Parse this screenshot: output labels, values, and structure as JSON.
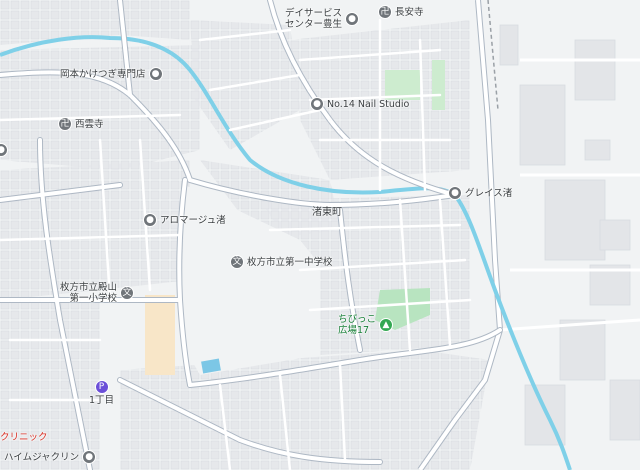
{
  "map": {
    "area_label": "渚東町",
    "pois": [
      {
        "id": "okamoto",
        "label": "岡本かけつぎ専門店",
        "icon": "shop-icon"
      },
      {
        "id": "saiun",
        "label": "西雲寺",
        "icon": "temple-icon"
      },
      {
        "id": "aroma",
        "label": "アロマージュ渚",
        "icon": "place-icon"
      },
      {
        "id": "daycare",
        "label_line1": "デイサービス",
        "label_line2": "センター豊生",
        "icon": "place-icon"
      },
      {
        "id": "chouanji",
        "label": "長安寺",
        "icon": "temple-icon"
      },
      {
        "id": "nail",
        "label": "No.14 Nail Studio",
        "icon": "place-icon"
      },
      {
        "id": "grace",
        "label": "グレイス渚",
        "icon": "place-icon"
      },
      {
        "id": "school1",
        "label": "枚方市立第一中学校",
        "icon": "school-icon"
      },
      {
        "id": "school2",
        "label_line1": "枚方市立殿山",
        "label_line2": "第一小学校",
        "icon": "school-icon"
      },
      {
        "id": "park",
        "label_line1": "ちびっこ",
        "label_line2": "広場17",
        "icon": "park-icon"
      },
      {
        "id": "parking",
        "label": "1丁目",
        "icon": "parking-icon"
      },
      {
        "id": "clinic",
        "label": "クリニック",
        "icon": ""
      },
      {
        "id": "haim",
        "label": "ハイムジャクリン",
        "icon": "place-icon"
      }
    ],
    "colors": {
      "background": "#f1f3f4",
      "road": "#ffffff",
      "road_casing": "#aeb8c4",
      "building": "#e8eaed",
      "river": "#7fd0e8",
      "park": "#b8e4c0",
      "school_ground": "#f8e6c8",
      "pool": "#7cc7e6"
    }
  }
}
